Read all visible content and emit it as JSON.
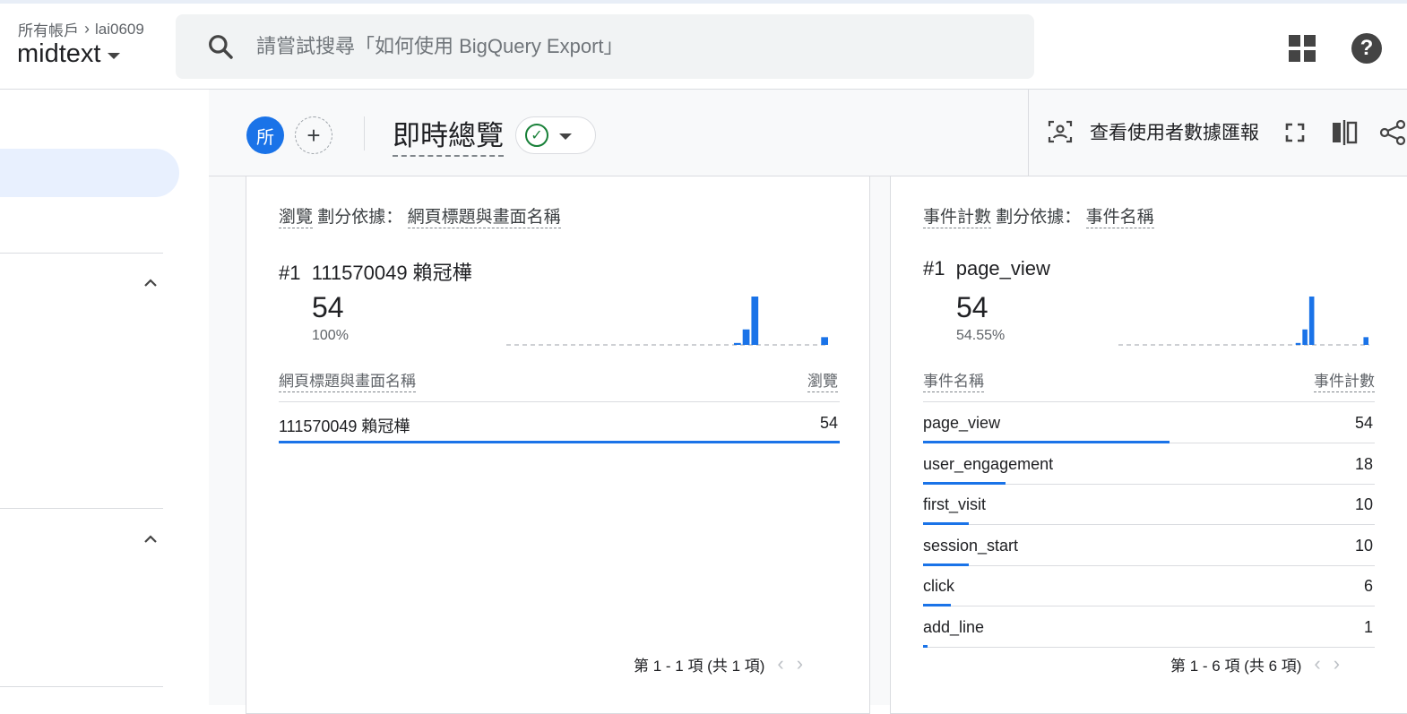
{
  "header": {
    "breadcrumb_root": "所有帳戶",
    "breadcrumb_account": "lai0609",
    "property": "midtext",
    "search_placeholder": "請嘗試搜尋「如何使用 BigQuery Export」"
  },
  "toolbar": {
    "comparison_chip": "所",
    "add_comparison": "+",
    "page_title": "即時總覽",
    "user_snapshot_label": "查看使用者數據匯報"
  },
  "card_views": {
    "metric": "瀏覽",
    "breakdown_label": "劃分依據：",
    "dimension": "網頁標題與畫面名稱",
    "top_rank": "#1",
    "top_name": "111570049 賴冠樺",
    "top_value": "54",
    "top_pct": "100%",
    "col_dimension": "網頁標題與畫面名稱",
    "col_metric": "瀏覽",
    "rows": [
      {
        "label": "111570049 賴冠樺",
        "value": "54",
        "share": 1.0
      }
    ],
    "pager": "第 1 - 1 項 (共 1 項)"
  },
  "card_events": {
    "metric": "事件計數",
    "breakdown_label": "劃分依據：",
    "dimension": "事件名稱",
    "top_rank": "#1",
    "top_name": "page_view",
    "top_value": "54",
    "top_pct": "54.55%",
    "col_dimension": "事件名稱",
    "col_metric": "事件計數",
    "rows": [
      {
        "label": "page_view",
        "value": "54",
        "share": 0.5455
      },
      {
        "label": "user_engagement",
        "value": "18",
        "share": 0.1818
      },
      {
        "label": "first_visit",
        "value": "10",
        "share": 0.101
      },
      {
        "label": "session_start",
        "value": "10",
        "share": 0.101
      },
      {
        "label": "click",
        "value": "6",
        "share": 0.0606
      },
      {
        "label": "add_line",
        "value": "1",
        "share": 0.0101
      }
    ],
    "pager": "第 1 - 6 項 (共 6 項)"
  },
  "sparklines": {
    "views": [
      0,
      0,
      0,
      0,
      0,
      0,
      0,
      0,
      0,
      0,
      0,
      0,
      0,
      0,
      0,
      0,
      0,
      0,
      0,
      0,
      0,
      0,
      0,
      0,
      0,
      0,
      1,
      8,
      25,
      0,
      0,
      0,
      0,
      0,
      0,
      0,
      4
    ],
    "events": [
      0,
      0,
      0,
      0,
      0,
      0,
      0,
      0,
      0,
      0,
      0,
      0,
      0,
      0,
      0,
      0,
      0,
      0,
      0,
      0,
      0,
      0,
      0,
      0,
      0,
      0,
      1,
      8,
      25,
      0,
      0,
      0,
      0,
      0,
      0,
      0,
      4
    ]
  },
  "colors": {
    "accent": "#1a73e8",
    "success": "#188038"
  }
}
